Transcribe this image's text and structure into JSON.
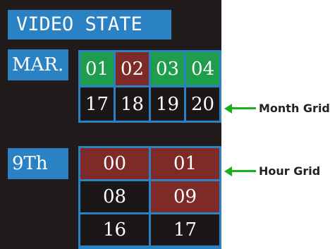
{
  "title": "VIDEO STATE",
  "month_label": "MAR.",
  "day_label": "9Th",
  "month_grid": {
    "days": [
      {
        "label": "01",
        "state": "green"
      },
      {
        "label": "02",
        "state": "red"
      },
      {
        "label": "03",
        "state": "green"
      },
      {
        "label": "04",
        "state": "green"
      },
      {
        "label": "17",
        "state": "black"
      },
      {
        "label": "18",
        "state": "black"
      },
      {
        "label": "19",
        "state": "black"
      },
      {
        "label": "20",
        "state": "black"
      }
    ]
  },
  "hour_grid": {
    "hours": [
      {
        "label": "00",
        "state": "red"
      },
      {
        "label": "01",
        "state": "red"
      },
      {
        "label": "08",
        "state": "black"
      },
      {
        "label": "09",
        "state": "red"
      },
      {
        "label": "16",
        "state": "black"
      },
      {
        "label": "17",
        "state": "black"
      }
    ]
  },
  "annotations": {
    "month": "Month Grid",
    "hour": "Hour Grid"
  },
  "colors": {
    "accent_blue": "#2a82c4",
    "recorded_green": "#1e9e4c",
    "alarm_red": "#7e2a26",
    "empty_black": "#1b1617",
    "annotation_green": "#19b01a"
  }
}
